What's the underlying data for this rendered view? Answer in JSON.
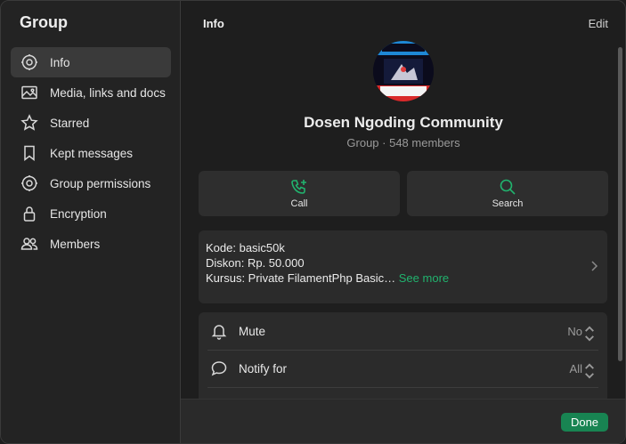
{
  "sidebar": {
    "title": "Group",
    "items": [
      {
        "label": "Info",
        "icon": "info-gear-icon",
        "active": true
      },
      {
        "label": "Media, links and docs",
        "icon": "image-icon"
      },
      {
        "label": "Starred",
        "icon": "star-icon"
      },
      {
        "label": "Kept messages",
        "icon": "bookmark-icon"
      },
      {
        "label": "Group permissions",
        "icon": "gear-icon"
      },
      {
        "label": "Encryption",
        "icon": "lock-icon"
      },
      {
        "label": "Members",
        "icon": "people-icon"
      }
    ]
  },
  "header": {
    "title": "Info",
    "edit_label": "Edit"
  },
  "group": {
    "name": "Dosen Ngoding Community",
    "meta": "Group · 548 members"
  },
  "actions": {
    "call_label": "Call",
    "search_label": "Search"
  },
  "description": {
    "line1": "Kode: basic50k",
    "line2": "Diskon: Rp. 50.000",
    "line3": "Kursus: Private FilamentPhp Basic…",
    "see_more": "See more"
  },
  "settings": [
    {
      "label": "Mute",
      "value": "No",
      "icon": "bell-icon"
    },
    {
      "label": "Notify for",
      "value": "All",
      "icon": "chat-bubble-icon"
    }
  ],
  "footer": {
    "done_label": "Done"
  },
  "colors": {
    "accent": "#21b36e",
    "done_button": "#188452",
    "background": "#1e1e1e",
    "sidebar_background": "#232323"
  }
}
